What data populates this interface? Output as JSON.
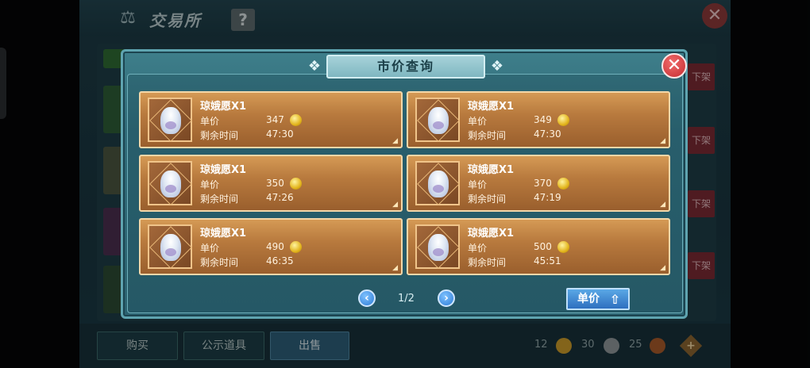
{
  "background": {
    "title": "交易所",
    "help_label": "?",
    "close_label": "✕",
    "unlist_label": "下架",
    "tabs": {
      "buy": "购买",
      "public": "公示道具",
      "sell": "出售"
    },
    "currencies": [
      {
        "amount": "12",
        "icon": "gold-coin-icon",
        "color": "#c99a2a"
      },
      {
        "amount": "30",
        "icon": "silver-coin-icon",
        "color": "#8e9699"
      },
      {
        "amount": "25",
        "icon": "copper-coin-icon",
        "color": "#a65a2a"
      }
    ],
    "plus_label": "+"
  },
  "modal": {
    "title": "市价查询",
    "close_label": "✕",
    "price_label": "单价",
    "time_label": "剩余时间",
    "listings": [
      {
        "name": "琼娥愿X1",
        "price": "347",
        "time": "47:30"
      },
      {
        "name": "琼娥愿X1",
        "price": "349",
        "time": "47:30"
      },
      {
        "name": "琼娥愿X1",
        "price": "350",
        "time": "47:26"
      },
      {
        "name": "琼娥愿X1",
        "price": "370",
        "time": "47:19"
      },
      {
        "name": "琼娥愿X1",
        "price": "490",
        "time": "46:35"
      },
      {
        "name": "琼娥愿X1",
        "price": "500",
        "time": "45:51"
      }
    ],
    "pagination": {
      "page_text": "1/2",
      "prev": "‹",
      "next": "›"
    },
    "sort_button": {
      "label": "单价",
      "direction_icon": "sort-arrow-up-icon"
    }
  }
}
